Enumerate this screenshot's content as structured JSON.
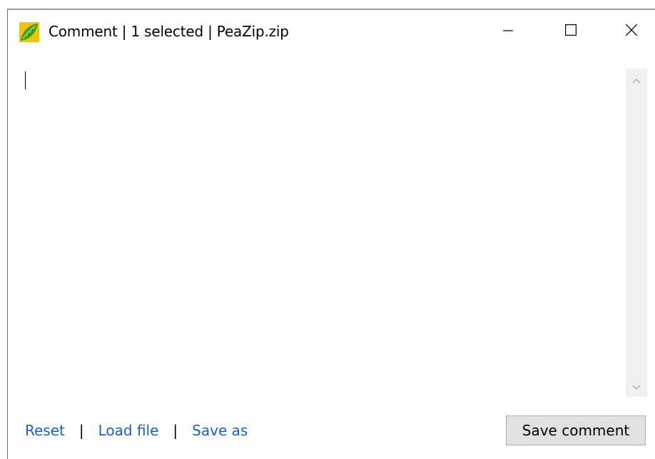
{
  "window": {
    "title": "Comment | 1 selected | PeaZip.zip",
    "icon": "peazip-app-icon",
    "controls": {
      "minimize": "minimize-icon",
      "maximize": "maximize-icon",
      "close": "close-icon"
    }
  },
  "editor": {
    "value": "",
    "scrollbar": {
      "up_icon": "chevron-up-icon",
      "down_icon": "chevron-down-icon"
    }
  },
  "footer": {
    "links": {
      "reset": "Reset",
      "load_file": "Load file",
      "save_as": "Save as"
    },
    "separator": "|",
    "save_button": "Save comment"
  },
  "colors": {
    "link": "#1a5fd0",
    "button_bg": "#e1e1e1",
    "scrollbar_bg": "#f0f0f0"
  }
}
